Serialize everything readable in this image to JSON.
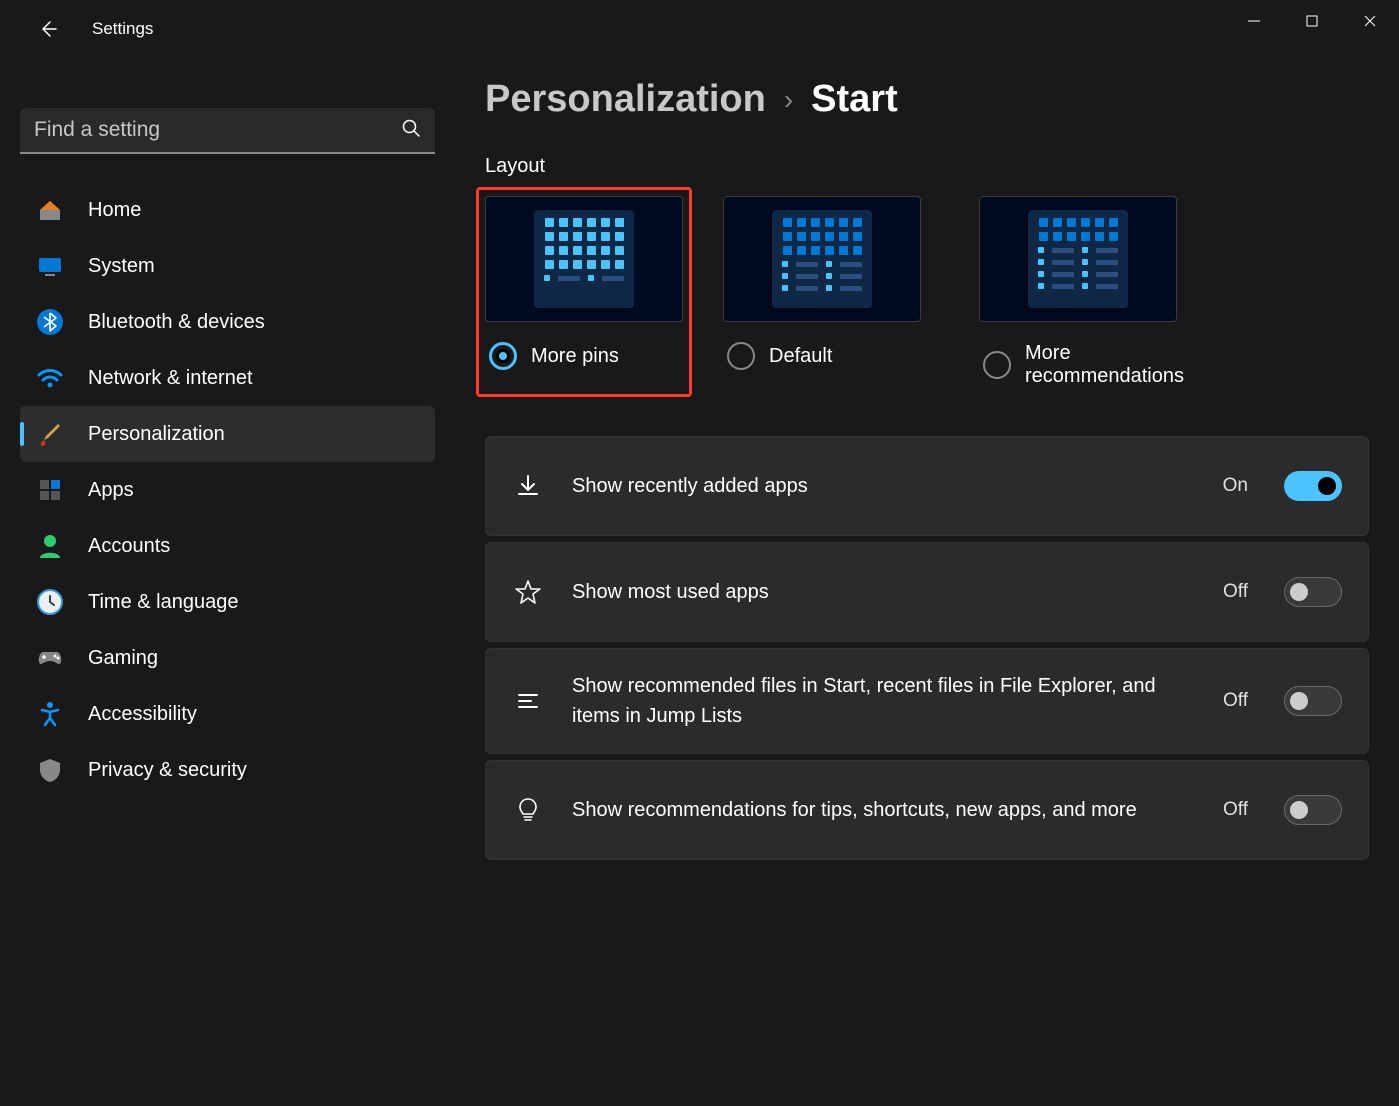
{
  "window": {
    "title": "Settings"
  },
  "search": {
    "placeholder": "Find a setting"
  },
  "sidebar": {
    "items": [
      {
        "id": "home",
        "label": "Home"
      },
      {
        "id": "system",
        "label": "System"
      },
      {
        "id": "bluetooth",
        "label": "Bluetooth & devices"
      },
      {
        "id": "network",
        "label": "Network & internet"
      },
      {
        "id": "personalization",
        "label": "Personalization"
      },
      {
        "id": "apps",
        "label": "Apps"
      },
      {
        "id": "accounts",
        "label": "Accounts"
      },
      {
        "id": "time",
        "label": "Time & language"
      },
      {
        "id": "gaming",
        "label": "Gaming"
      },
      {
        "id": "accessibility",
        "label": "Accessibility"
      },
      {
        "id": "privacy",
        "label": "Privacy & security"
      }
    ],
    "active_index": 4
  },
  "breadcrumb": {
    "parent": "Personalization",
    "current": "Start"
  },
  "layout": {
    "title": "Layout",
    "options": [
      {
        "label": "More pins",
        "selected": true,
        "highlighted": true
      },
      {
        "label": "Default",
        "selected": false,
        "highlighted": false
      },
      {
        "label": "More recommendations",
        "selected": false,
        "highlighted": false
      }
    ]
  },
  "settings": [
    {
      "icon": "download",
      "label": "Show recently added apps",
      "status": "On",
      "on": true
    },
    {
      "icon": "star",
      "label": "Show most used apps",
      "status": "Off",
      "on": false
    },
    {
      "icon": "list",
      "label": "Show recommended files in Start, recent files in File Explorer, and items in Jump Lists",
      "status": "Off",
      "on": false
    },
    {
      "icon": "bulb",
      "label": "Show recommendations for tips, shortcuts, new apps, and more",
      "status": "Off",
      "on": false
    }
  ]
}
